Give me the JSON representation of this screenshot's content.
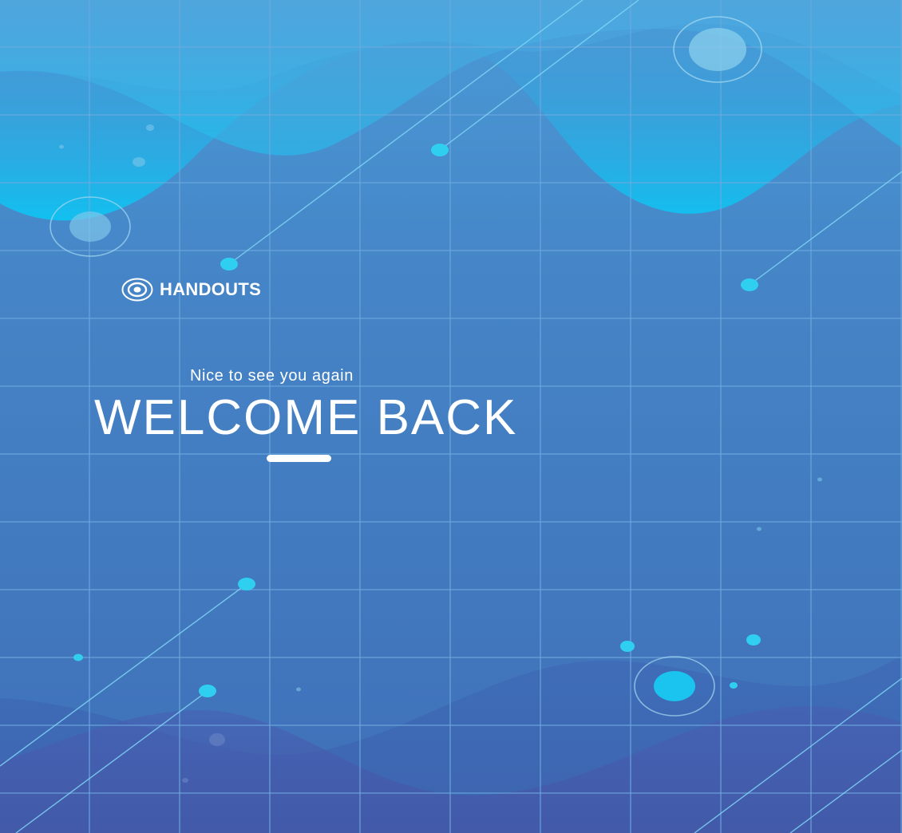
{
  "brand": {
    "name": "HANDOUTS",
    "logo_icon": "concentric-circles-icon"
  },
  "welcome": {
    "subtitle": "Nice to see you again",
    "title": "WELCOME BACK"
  },
  "theme": {
    "background": "#4580c4",
    "grid_line": "#6aa6dc",
    "top_wave": "#14c0f0",
    "bottom_wave": "#4a58a8",
    "node": "#2fd0ef",
    "accent_white": "#ffffff"
  }
}
